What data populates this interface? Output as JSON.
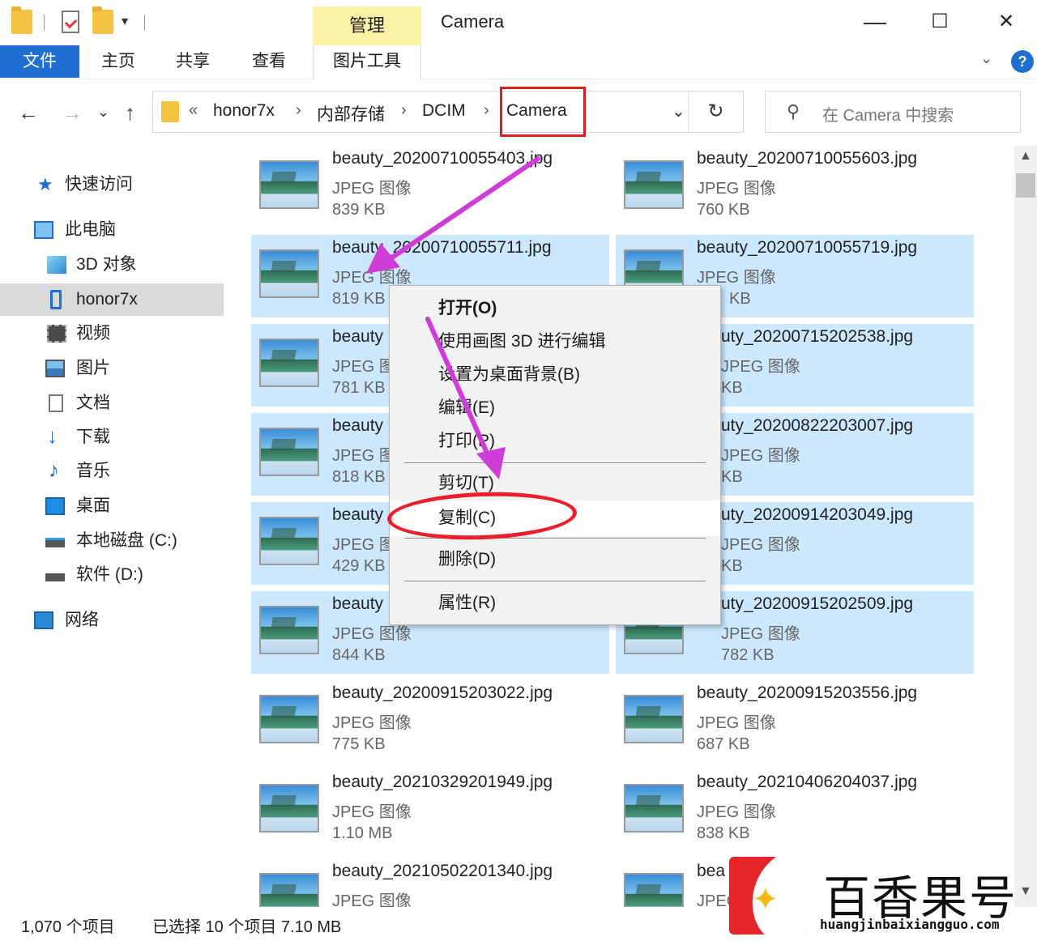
{
  "titlebar": {
    "contextual_tab": "管理",
    "window_title": "Camera",
    "dropdown_glyph": "▾",
    "minimize": "—",
    "maximize": "☐",
    "close": "✕"
  },
  "ribbon": {
    "tabs": [
      "文件",
      "主页",
      "共享",
      "查看",
      "图片工具"
    ],
    "expand_glyph": "⌄",
    "help_glyph": "?",
    "accent_color": "#1e6fd0",
    "manage_tab_color": "#fbf2a6"
  },
  "nav": {
    "back": "←",
    "forward": "→",
    "recent": "⌄",
    "up": "↑",
    "breadcrumb": {
      "overflow": "«",
      "items": [
        "honor7x",
        "内部存储",
        "DCIM",
        "Camera"
      ],
      "separator": "›"
    },
    "refresh": "↻",
    "dropdown": "⌄"
  },
  "search": {
    "icon": "⚲",
    "placeholder": "在 Camera 中搜索"
  },
  "sidebar": {
    "items": [
      {
        "label": "快速访问",
        "icon": "star-icon"
      },
      {
        "label": "此电脑",
        "icon": "computer-icon"
      },
      {
        "label": "3D 对象",
        "icon": "cube-icon"
      },
      {
        "label": "honor7x",
        "icon": "phone-icon"
      },
      {
        "label": "视频",
        "icon": "video-icon"
      },
      {
        "label": "图片",
        "icon": "pictures-icon"
      },
      {
        "label": "文档",
        "icon": "documents-icon"
      },
      {
        "label": "下载",
        "icon": "download-icon"
      },
      {
        "label": "音乐",
        "icon": "music-icon"
      },
      {
        "label": "桌面",
        "icon": "desktop-icon"
      },
      {
        "label": "本地磁盘 (C:)",
        "icon": "drive-icon"
      },
      {
        "label": "软件 (D:)",
        "icon": "drive-icon"
      },
      {
        "label": "网络",
        "icon": "network-icon"
      }
    ]
  },
  "files": {
    "type_label": "JPEG 图像",
    "left": [
      {
        "name": "beauty_20200710055403.jpg",
        "size": "839 KB",
        "selected": false
      },
      {
        "name": "beauty_20200710055711.jpg",
        "size": "819 KB",
        "selected": true
      },
      {
        "name": "beauty",
        "size": "781 KB",
        "selected": true
      },
      {
        "name": "beauty",
        "size": "818 KB",
        "selected": true
      },
      {
        "name": "beauty",
        "size": "429 KB",
        "selected": true
      },
      {
        "name": "beauty",
        "size": "844 KB",
        "selected": true
      },
      {
        "name": "beauty_20200915203022.jpg",
        "size": "775 KB",
        "selected": false
      },
      {
        "name": "beauty_20210329201949.jpg",
        "size": "1.10 MB",
        "selected": false
      },
      {
        "name": "beauty_20210502201340.jpg",
        "size": "",
        "selected": false
      }
    ],
    "right": [
      {
        "name": "beauty_20200710055603.jpg",
        "size": "760 KB",
        "selected": false
      },
      {
        "name": "beauty_20200710055719.jpg",
        "size": "KB",
        "selected": true
      },
      {
        "name": "uty_20200715202538.jpg",
        "size": "KB",
        "selected": true
      },
      {
        "name": "uty_20200822203007.jpg",
        "size": "KB",
        "selected": true
      },
      {
        "name": "uty_20200914203049.jpg",
        "size": "KB",
        "selected": true
      },
      {
        "name": "uty_20200915202509.jpg",
        "size": "782 KB",
        "selected": true
      },
      {
        "name": "beauty_20200915203556.jpg",
        "size": "687 KB",
        "selected": false
      },
      {
        "name": "beauty_20210406204037.jpg",
        "size": "838 KB",
        "selected": false
      },
      {
        "name": "bea",
        "size": "",
        "selected": false
      }
    ]
  },
  "context_menu": {
    "items": [
      {
        "label": "打开(O)",
        "bold": true
      },
      {
        "label": "使用画图 3D 进行编辑"
      },
      {
        "label": "设置为桌面背景(B)"
      },
      {
        "label": "编辑(E)"
      },
      {
        "label": "打印(P)"
      },
      {
        "label": "剪切(T)"
      },
      {
        "label": "复制(C)",
        "highlighted": true
      },
      {
        "label": "删除(D)"
      },
      {
        "label": "属性(R)"
      }
    ]
  },
  "statusbar": {
    "count": "1,070 个项目",
    "selected": "已选择 10 个项目  7.10 MB"
  },
  "annotations": {
    "arrow_color": "#d03cd8",
    "highlight_color": "#e02020"
  },
  "watermark": {
    "text": "百香果号",
    "url": "huangjinbaixiangguo.com"
  }
}
